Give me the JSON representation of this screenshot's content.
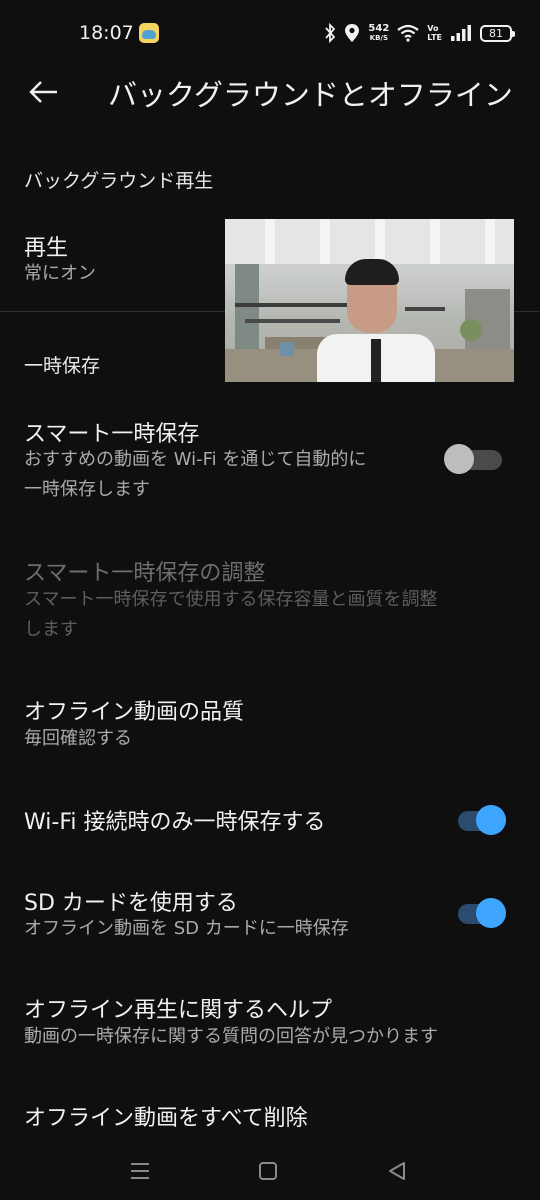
{
  "status_bar": {
    "time": "18:07",
    "net_speed_value": "542",
    "net_speed_unit": "KB/S",
    "network_label_top": "Vo",
    "network_label_bottom": "LTE",
    "battery": "81",
    "icons": [
      "gallery-app-icon",
      "bluetooth-icon",
      "location-icon",
      "wifi-icon",
      "signal-icon",
      "battery-icon"
    ]
  },
  "header": {
    "title": "バックグラウンドとオフライン",
    "back_icon": "arrow-left-icon"
  },
  "sections": {
    "background": {
      "header": "バックグラウンド再生",
      "playback_title": "再生",
      "playback_value": "常にオン"
    },
    "offline": {
      "header": "一時保存",
      "smart_download_title": "スマート一時保存",
      "smart_download_desc_line1": "おすすめの動画を Wi-Fi を通じて自動的に",
      "smart_download_desc_line2": "一時保存します",
      "smart_download_enabled": false,
      "smart_adjust_title": "スマート一時保存の調整",
      "smart_adjust_desc_line1": "スマート一時保存で使用する保存容量と画質を調整",
      "smart_adjust_desc_line2": "します",
      "quality_title": "オフライン動画の品質",
      "quality_value": "毎回確認する",
      "wifi_only_title": "Wi-Fi 接続時のみ一時保存する",
      "wifi_only_enabled": true,
      "sd_card_title": "SD カードを使用する",
      "sd_card_desc": "オフライン動画を SD カードに一時保存",
      "sd_card_enabled": true,
      "help_title": "オフライン再生に関するヘルプ",
      "help_desc": "動画の一時保存に関する質問の回答が見つかります",
      "delete_all_title": "オフライン動画をすべて削除"
    }
  },
  "colors": {
    "background": "#0f0f0f",
    "toggle_on": "#3ea6ff",
    "toggle_off": "#bdbdbd"
  },
  "nav_bar": {
    "icons": [
      "recents-menu-icon",
      "home-square-icon",
      "back-triangle-icon"
    ]
  }
}
